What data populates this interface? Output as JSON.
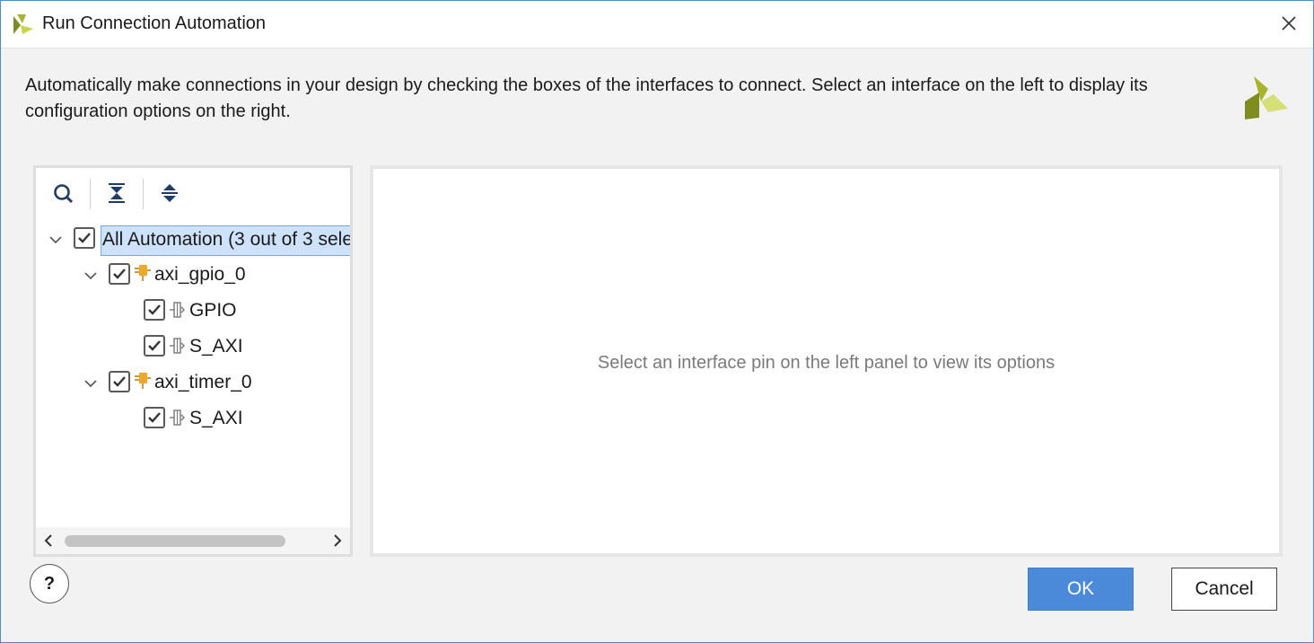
{
  "window": {
    "title": "Run Connection Automation",
    "description": "Automatically make connections in your design by checking the boxes of the interfaces to connect. Select an interface on the left to display its configuration options on the right."
  },
  "toolbar": {
    "icons": [
      "search-icon",
      "collapse-all-icon",
      "expand-all-icon"
    ]
  },
  "tree": {
    "root": {
      "label": "All Automation (3 out of 3 sele",
      "checked": true,
      "expanded": true,
      "selected": true
    },
    "nodes": [
      {
        "label": "axi_gpio_0",
        "checked": true,
        "expanded": true,
        "icon": "ip-block-icon",
        "children": [
          {
            "label": "GPIO",
            "checked": true,
            "icon": "interface-pin-icon"
          },
          {
            "label": "S_AXI",
            "checked": true,
            "icon": "interface-pin-icon"
          }
        ]
      },
      {
        "label": "axi_timer_0",
        "checked": true,
        "expanded": true,
        "icon": "ip-block-icon",
        "children": [
          {
            "label": "S_AXI",
            "checked": true,
            "icon": "interface-pin-icon"
          }
        ]
      }
    ]
  },
  "options_panel": {
    "placeholder": "Select an interface pin on the left panel to view its options"
  },
  "buttons": {
    "help": "?",
    "ok": "OK",
    "cancel": "Cancel"
  },
  "colors": {
    "accent": "#4b8ad8",
    "selection": "#cfe2fb",
    "logo_yellow": "#c9d44a",
    "logo_olive": "#7f8c1e"
  }
}
